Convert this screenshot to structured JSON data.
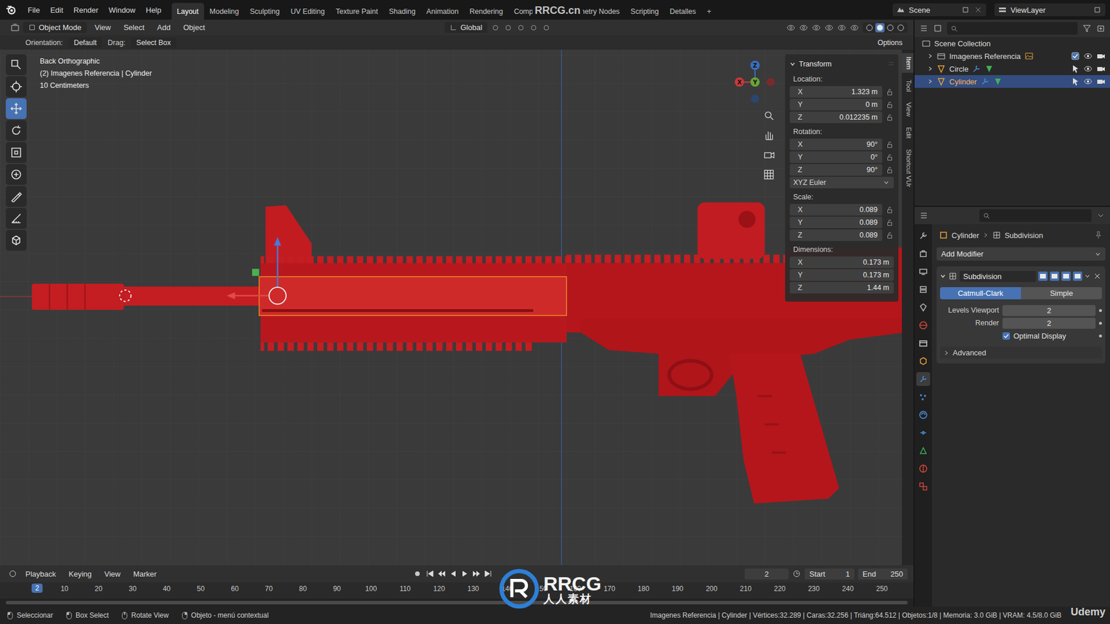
{
  "topbar": {
    "menus": [
      "File",
      "Edit",
      "Render",
      "Window",
      "Help"
    ],
    "workspaces": [
      {
        "label": "Layout",
        "selected": true
      },
      {
        "label": "Modeling",
        "selected": false
      },
      {
        "label": "Sculpting",
        "selected": false
      },
      {
        "label": "UV Editing",
        "selected": false
      },
      {
        "label": "Texture Paint",
        "selected": false
      },
      {
        "label": "Shading",
        "selected": false
      },
      {
        "label": "Animation",
        "selected": false
      },
      {
        "label": "Rendering",
        "selected": false
      },
      {
        "label": "Compositing",
        "selected": false
      },
      {
        "label": "Geometry Nodes",
        "selected": false
      },
      {
        "label": "Scripting",
        "selected": false
      },
      {
        "label": "Detalles",
        "selected": false
      }
    ],
    "add_workspace": "+",
    "scene": "Scene",
    "view_layer": "ViewLayer"
  },
  "viewport_header": {
    "mode": "Object Mode",
    "menus": [
      "View",
      "Select",
      "Add",
      "Object"
    ],
    "transform_orientation": "Global"
  },
  "tool_settings": {
    "orientation_label": "Orientation:",
    "orientation": "Default",
    "drag_label": "Drag:",
    "drag": "Select Box",
    "options": "Options"
  },
  "viewport_info": [
    "Back Orthographic",
    "(2) Imagenes Referencia | Cylinder",
    "10 Centimeters"
  ],
  "toolbar": [
    {
      "selected": false
    },
    {
      "selected": false
    },
    {
      "selected": true
    },
    {
      "selected": false
    },
    {
      "selected": false
    },
    {
      "selected": false
    },
    {
      "selected": false
    },
    {
      "selected": false
    },
    {
      "selected": false
    }
  ],
  "gizmo": {
    "axes": [
      "Z",
      "Y",
      "X"
    ]
  },
  "sidebar_tabs": [
    {
      "label": "Item",
      "selected": true
    },
    {
      "label": "Tool",
      "selected": false
    },
    {
      "label": "View",
      "selected": false
    },
    {
      "label": "Edit",
      "selected": false
    },
    {
      "label": "Shortcut VUr",
      "selected": false
    }
  ],
  "transform": {
    "title": "Transform",
    "expanded": true,
    "groups": [
      {
        "label": "Location:",
        "kind": "lockable",
        "fields": [
          {
            "axis": "X",
            "value": "1.323 m",
            "locked": false
          },
          {
            "axis": "Y",
            "value": "0 m",
            "locked": false
          },
          {
            "axis": "Z",
            "value": "0.012235 m",
            "locked": false
          }
        ]
      },
      {
        "label": "Rotation:",
        "kind": "lockable",
        "fields": [
          {
            "axis": "X",
            "value": "90°",
            "locked": false
          },
          {
            "axis": "Y",
            "value": "0°",
            "locked": false
          },
          {
            "axis": "Z",
            "value": "90°",
            "locked": false
          }
        ],
        "mode": "XYZ Euler"
      },
      {
        "label": "Scale:",
        "kind": "lockable",
        "fields": [
          {
            "axis": "X",
            "value": "0.089",
            "locked": false
          },
          {
            "axis": "Y",
            "value": "0.089",
            "locked": false
          },
          {
            "axis": "Z",
            "value": "0.089",
            "locked": false
          }
        ]
      },
      {
        "label": "Dimensions:",
        "kind": "plain",
        "fields": [
          {
            "axis": "X",
            "value": "0.173 m",
            "locked": false
          },
          {
            "axis": "Y",
            "value": "0.173 m",
            "locked": false
          },
          {
            "axis": "Z",
            "value": "1.44 m",
            "locked": false
          }
        ]
      }
    ]
  },
  "outliner": {
    "items": [
      {
        "label": "Scene Collection",
        "kind": "root",
        "expanded": true,
        "selected": false,
        "visible": true,
        "included": true
      },
      {
        "label": "Imagenes Referencia",
        "kind": "collection",
        "expanded": false,
        "selected": false,
        "visible": true,
        "included": true
      },
      {
        "label": "Circle",
        "kind": "object",
        "expanded": false,
        "selected": false,
        "visible": true,
        "included": true
      },
      {
        "label": "Cylinder",
        "kind": "object",
        "expanded": false,
        "selected": true,
        "visible": true,
        "included": true
      }
    ]
  },
  "properties": {
    "breadcrumb": [
      "Cylinder",
      "Subdivision"
    ],
    "tabs": [
      {
        "selected": false
      },
      {
        "selected": false
      },
      {
        "selected": false
      },
      {
        "selected": false
      },
      {
        "selected": false
      },
      {
        "selected": false
      },
      {
        "selected": false
      },
      {
        "selected": false
      },
      {
        "selected": true
      },
      {
        "selected": false
      },
      {
        "selected": false
      },
      {
        "selected": false
      },
      {
        "selected": false
      },
      {
        "selected": false
      },
      {
        "selected": false
      }
    ],
    "add_modifier": "Add Modifier",
    "modifier": {
      "name": "Subdivision",
      "expanded": true,
      "types": [
        {
          "label": "Catmull-Clark",
          "selected": true
        },
        {
          "label": "Simple",
          "selected": false
        }
      ],
      "fields": [
        {
          "label": "Levels Viewport",
          "value": "2"
        },
        {
          "label": "Render",
          "value": "2"
        }
      ],
      "optimal_display": {
        "label": "Optimal Display",
        "checked": true
      },
      "advanced": {
        "label": "Advanced",
        "expanded": false
      }
    }
  },
  "timeline": {
    "menus": [
      "Playback",
      "Keying",
      "View",
      "Marker"
    ],
    "current_frame": "2",
    "start_label": "Start",
    "start": "1",
    "end_label": "End",
    "end": "250",
    "playhead": "2",
    "ticks": [
      "10",
      "20",
      "30",
      "40",
      "50",
      "60",
      "70",
      "80",
      "90",
      "100",
      "110",
      "120",
      "130",
      "140",
      "150",
      "160",
      "170",
      "180",
      "190",
      "200",
      "210",
      "220",
      "230",
      "240",
      "250"
    ]
  },
  "status_bar": {
    "hints": [
      "Seleccionar",
      "Box Select",
      "Rotate View",
      "Objeto - menú contextual"
    ],
    "stats": "Imagenes Referencia | Cylinder | Vértices:32.289 | Caras:32.256 | Triáng:64.512 | Objetos:1/8 | Memoria: 3.0 GiB | VRAM: 4.5/8.0 GiB"
  },
  "watermarks": {
    "top": "RRCG.cn",
    "logo": "RRCG",
    "logo_sub": "人人素材",
    "corner": "Udemy"
  }
}
